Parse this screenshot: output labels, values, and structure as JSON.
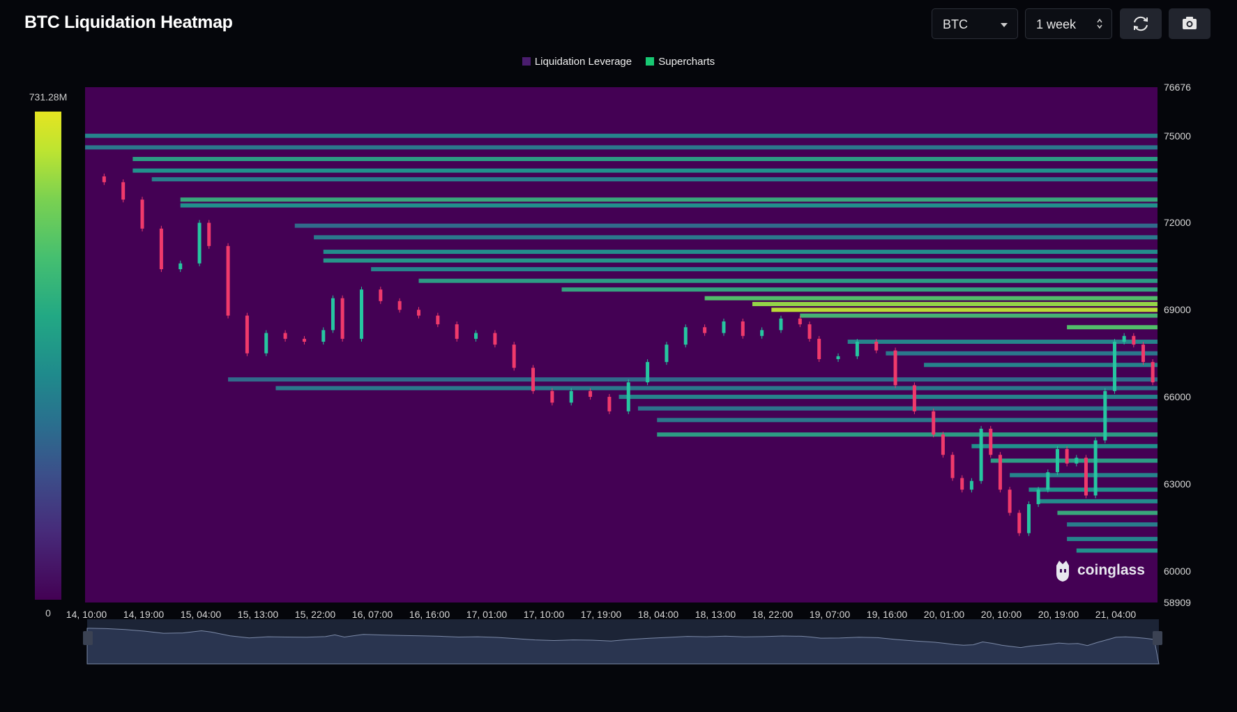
{
  "header": {
    "title": "BTC Liquidation Heatmap"
  },
  "controls": {
    "coin": {
      "value": "BTC"
    },
    "range": {
      "value": "1 week"
    },
    "refresh_icon": "refresh-icon",
    "camera_icon": "camera-icon"
  },
  "brand": {
    "name": "coinglass"
  },
  "colors": {
    "background": "#05060b",
    "heat_low": "#440154",
    "heat_high": "#e5e421",
    "candle_up": "#26c6a0",
    "candle_down": "#f03a6b",
    "navigator_fill": "#2a3550"
  },
  "chart_data": {
    "type": "heatmap",
    "title": "BTC Liquidation Heatmap",
    "legend": [
      {
        "name": "Liquidation Leverage",
        "color": "#4a1d6e"
      },
      {
        "name": "Supercharts",
        "color": "#18c873"
      }
    ],
    "legend_position": "top-center",
    "colorbar": {
      "max_label": "731.28M",
      "min_label": "0",
      "max": 731280000,
      "min": 0
    },
    "y_axis": {
      "position": "right",
      "range": [
        58909,
        76676
      ],
      "ticks": [
        "76676",
        "75000",
        "72000",
        "69000",
        "66000",
        "63000",
        "60000",
        "58909"
      ]
    },
    "x_axis": {
      "ticks": [
        "14, 10:00",
        "14, 19:00",
        "15, 04:00",
        "15, 13:00",
        "15, 22:00",
        "16, 07:00",
        "16, 16:00",
        "17, 01:00",
        "17, 10:00",
        "17, 19:00",
        "18, 04:00",
        "18, 13:00",
        "18, 22:00",
        "19, 07:00",
        "19, 16:00",
        "20, 01:00",
        "20, 10:00",
        "20, 19:00",
        "21, 04:00"
      ]
    },
    "price_path": [
      [
        0,
        73600
      ],
      [
        0.02,
        73400
      ],
      [
        0.04,
        72800
      ],
      [
        0.06,
        71800
      ],
      [
        0.08,
        70400
      ],
      [
        0.1,
        70600
      ],
      [
        0.12,
        72000
      ],
      [
        0.13,
        71200
      ],
      [
        0.15,
        68800
      ],
      [
        0.17,
        67500
      ],
      [
        0.19,
        68200
      ],
      [
        0.21,
        68000
      ],
      [
        0.23,
        67900
      ],
      [
        0.25,
        68300
      ],
      [
        0.26,
        69400
      ],
      [
        0.27,
        68000
      ],
      [
        0.29,
        69700
      ],
      [
        0.31,
        69300
      ],
      [
        0.33,
        69000
      ],
      [
        0.35,
        68800
      ],
      [
        0.37,
        68500
      ],
      [
        0.39,
        68000
      ],
      [
        0.41,
        68200
      ],
      [
        0.43,
        67800
      ],
      [
        0.45,
        67000
      ],
      [
        0.47,
        66200
      ],
      [
        0.49,
        65800
      ],
      [
        0.51,
        66200
      ],
      [
        0.53,
        66000
      ],
      [
        0.55,
        65500
      ],
      [
        0.57,
        66500
      ],
      [
        0.59,
        67200
      ],
      [
        0.61,
        67800
      ],
      [
        0.63,
        68400
      ],
      [
        0.65,
        68200
      ],
      [
        0.67,
        68600
      ],
      [
        0.69,
        68100
      ],
      [
        0.71,
        68300
      ],
      [
        0.73,
        68700
      ],
      [
        0.75,
        68500
      ],
      [
        0.76,
        68000
      ],
      [
        0.77,
        67300
      ],
      [
        0.79,
        67400
      ],
      [
        0.81,
        67900
      ],
      [
        0.83,
        67600
      ],
      [
        0.85,
        66400
      ],
      [
        0.87,
        65500
      ],
      [
        0.89,
        64700
      ],
      [
        0.9,
        64000
      ],
      [
        0.91,
        63200
      ],
      [
        0.92,
        62800
      ],
      [
        0.93,
        63100
      ],
      [
        0.94,
        64900
      ],
      [
        0.95,
        64000
      ],
      [
        0.96,
        62800
      ],
      [
        0.97,
        62000
      ],
      [
        0.98,
        61300
      ],
      [
        0.99,
        62300
      ],
      [
        1.0,
        62800
      ],
      [
        1.01,
        63400
      ],
      [
        1.02,
        64200
      ],
      [
        1.03,
        63700
      ],
      [
        1.04,
        63900
      ],
      [
        1.05,
        62600
      ],
      [
        1.06,
        64500
      ],
      [
        1.07,
        66200
      ],
      [
        1.08,
        67900
      ],
      [
        1.09,
        68100
      ],
      [
        1.1,
        67800
      ],
      [
        1.11,
        67200
      ],
      [
        1.12,
        66500
      ]
    ],
    "liquidation_levels": [
      {
        "price": 75000,
        "start": 0.0,
        "value": 0.45
      },
      {
        "price": 74600,
        "start": 0.0,
        "value": 0.4
      },
      {
        "price": 74200,
        "start": 0.05,
        "value": 0.55
      },
      {
        "price": 73800,
        "start": 0.05,
        "value": 0.5
      },
      {
        "price": 73500,
        "start": 0.07,
        "value": 0.42
      },
      {
        "price": 72800,
        "start": 0.1,
        "value": 0.6
      },
      {
        "price": 72600,
        "start": 0.1,
        "value": 0.5
      },
      {
        "price": 71900,
        "start": 0.22,
        "value": 0.35
      },
      {
        "price": 71500,
        "start": 0.24,
        "value": 0.4
      },
      {
        "price": 71000,
        "start": 0.25,
        "value": 0.48
      },
      {
        "price": 70700,
        "start": 0.25,
        "value": 0.52
      },
      {
        "price": 70400,
        "start": 0.3,
        "value": 0.45
      },
      {
        "price": 70000,
        "start": 0.35,
        "value": 0.55
      },
      {
        "price": 69700,
        "start": 0.5,
        "value": 0.58
      },
      {
        "price": 69400,
        "start": 0.65,
        "value": 0.7
      },
      {
        "price": 69200,
        "start": 0.7,
        "value": 0.85
      },
      {
        "price": 69000,
        "start": 0.72,
        "value": 0.92
      },
      {
        "price": 68800,
        "start": 0.75,
        "value": 0.65
      },
      {
        "price": 68400,
        "start": 1.03,
        "value": 0.7
      },
      {
        "price": 67900,
        "start": 0.8,
        "value": 0.45
      },
      {
        "price": 67500,
        "start": 0.84,
        "value": 0.4
      },
      {
        "price": 67100,
        "start": 0.88,
        "value": 0.45
      },
      {
        "price": 66600,
        "start": 0.15,
        "value": 0.35
      },
      {
        "price": 66300,
        "start": 0.2,
        "value": 0.4
      },
      {
        "price": 66000,
        "start": 0.56,
        "value": 0.45
      },
      {
        "price": 65600,
        "start": 0.58,
        "value": 0.38
      },
      {
        "price": 65200,
        "start": 0.6,
        "value": 0.4
      },
      {
        "price": 64700,
        "start": 0.6,
        "value": 0.55
      },
      {
        "price": 64300,
        "start": 0.93,
        "value": 0.5
      },
      {
        "price": 63800,
        "start": 0.95,
        "value": 0.55
      },
      {
        "price": 63300,
        "start": 0.97,
        "value": 0.45
      },
      {
        "price": 62800,
        "start": 0.99,
        "value": 0.5
      },
      {
        "price": 62400,
        "start": 1.0,
        "value": 0.48
      },
      {
        "price": 62000,
        "start": 1.02,
        "value": 0.6
      },
      {
        "price": 61600,
        "start": 1.03,
        "value": 0.42
      },
      {
        "price": 61100,
        "start": 1.03,
        "value": 0.45
      },
      {
        "price": 60700,
        "start": 1.04,
        "value": 0.5
      }
    ]
  }
}
